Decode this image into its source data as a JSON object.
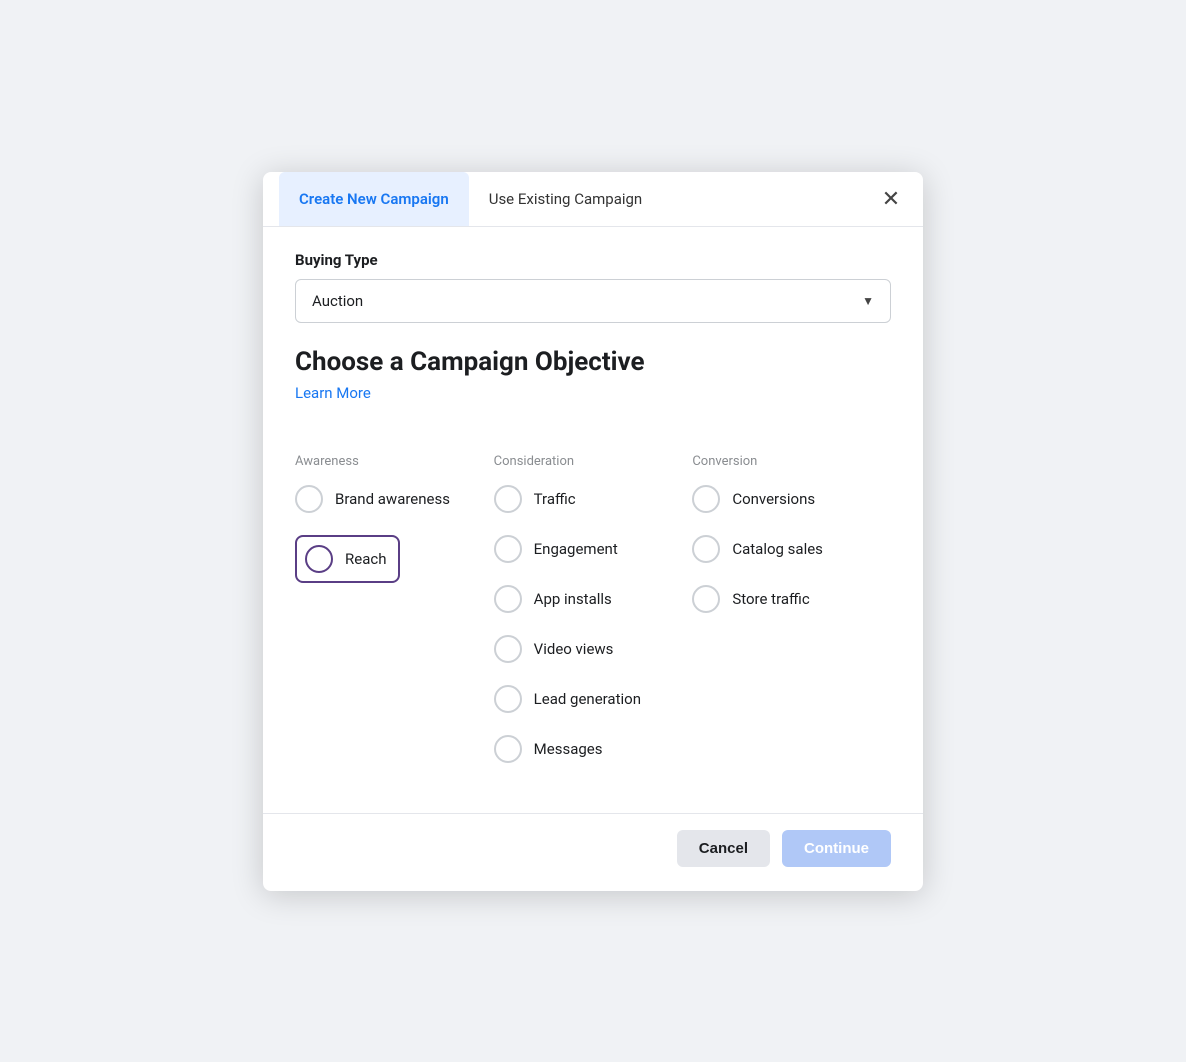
{
  "tabs": {
    "create": "Create New Campaign",
    "use_existing": "Use Existing Campaign"
  },
  "close_icon": "✕",
  "buying_type": {
    "label": "Buying Type",
    "value": "Auction"
  },
  "campaign_objective": {
    "title": "Choose a Campaign Objective",
    "learn_more": "Learn More"
  },
  "columns": {
    "awareness": "Awareness",
    "consideration": "Consideration",
    "conversion": "Conversion"
  },
  "awareness_items": [
    {
      "id": "brand_awareness",
      "label": "Brand awareness"
    },
    {
      "id": "reach",
      "label": "Reach"
    }
  ],
  "consideration_items": [
    {
      "id": "traffic",
      "label": "Traffic"
    },
    {
      "id": "engagement",
      "label": "Engagement"
    },
    {
      "id": "app_installs",
      "label": "App installs"
    },
    {
      "id": "video_views",
      "label": "Video views"
    },
    {
      "id": "lead_generation",
      "label": "Lead generation"
    },
    {
      "id": "messages",
      "label": "Messages"
    }
  ],
  "conversion_items": [
    {
      "id": "conversions",
      "label": "Conversions"
    },
    {
      "id": "catalog_sales",
      "label": "Catalog sales"
    },
    {
      "id": "store_traffic",
      "label": "Store traffic"
    }
  ],
  "footer": {
    "cancel": "Cancel",
    "continue": "Continue"
  },
  "colors": {
    "active_tab_bg": "#e7f0ff",
    "active_tab_text": "#1877f2",
    "learn_more": "#1877f2",
    "reach_border": "#5a3e85",
    "continue_bg": "#b0c8f7"
  }
}
